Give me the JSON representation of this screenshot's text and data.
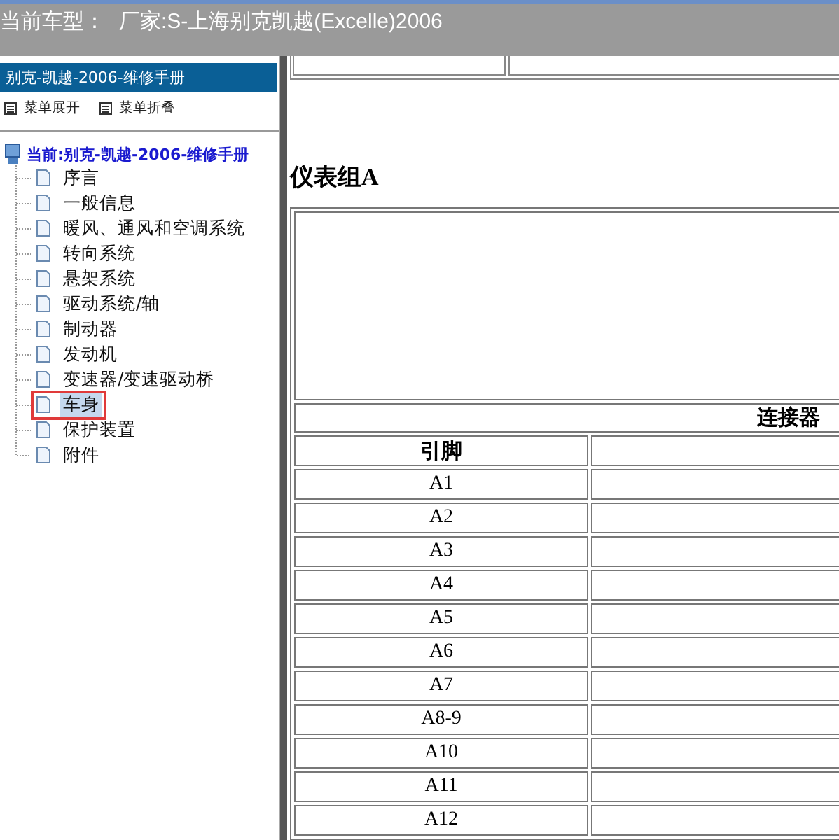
{
  "header": {
    "label": "当前车型：",
    "value": "厂家:S-上海别克凯越(Excelle)2006"
  },
  "sidebar": {
    "title": "别克-凯越-2006-维修手册",
    "menu": [
      "菜单展开",
      "菜单折叠"
    ],
    "tree": {
      "label": "当前:别克-凯越-2006-维修手册",
      "children": [
        {
          "label": "序言",
          "selected": false
        },
        {
          "label": "一般信息",
          "selected": false
        },
        {
          "label": "暖风、通风和空调系统",
          "selected": false
        },
        {
          "label": "转向系统",
          "selected": false
        },
        {
          "label": "悬架系统",
          "selected": false
        },
        {
          "label": "驱动系统/轴",
          "selected": false
        },
        {
          "label": "制动器",
          "selected": false
        },
        {
          "label": "发动机",
          "selected": false
        },
        {
          "label": "变速器/变速驱动桥",
          "selected": false
        },
        {
          "label": "车身",
          "selected": true
        },
        {
          "label": "保护装置",
          "selected": false
        },
        {
          "label": "附件",
          "selected": false
        }
      ]
    }
  },
  "content": {
    "heading": "仪表组A",
    "table": {
      "title": "连接器",
      "columns": [
        "引脚"
      ],
      "rows": [
        "A1",
        "A2",
        "A3",
        "A4",
        "A5",
        "A6",
        "A7",
        "A8-9",
        "A10",
        "A11",
        "A12"
      ]
    }
  }
}
